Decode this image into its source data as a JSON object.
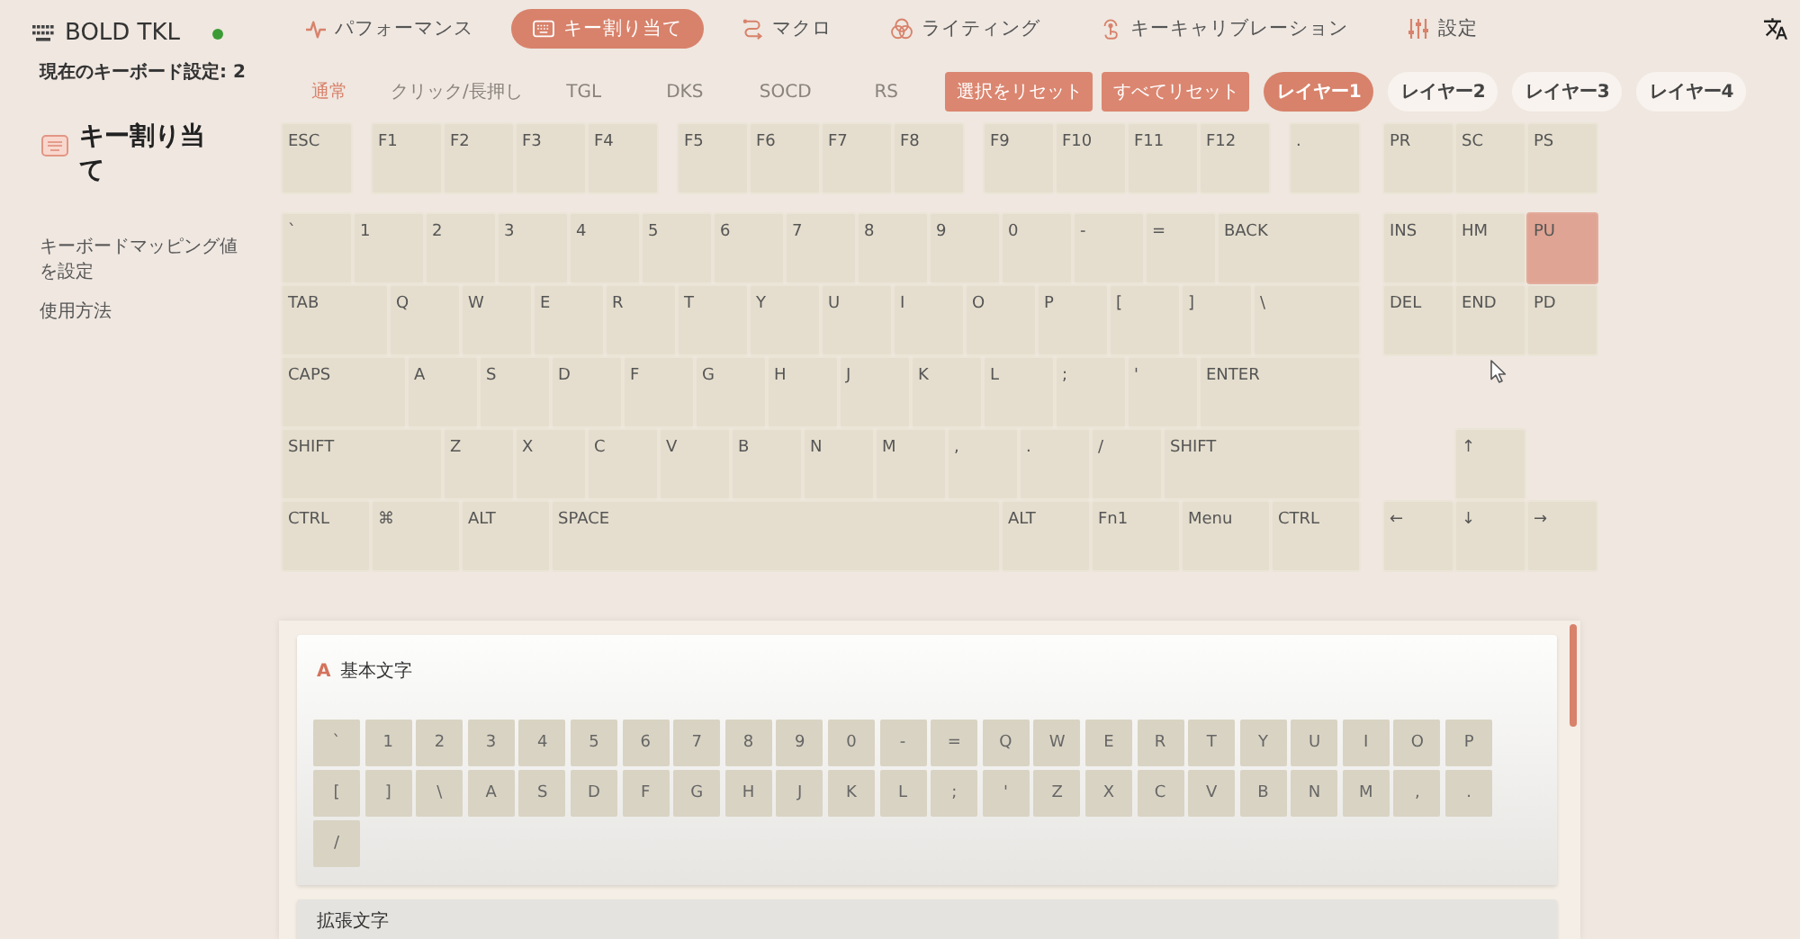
{
  "sidebar": {
    "device": {
      "name": "BOLD TKL",
      "connected": true
    },
    "profile": "現在のキーボード設定: 2",
    "section": "キー割り当て",
    "links": [
      "キーボードマッピング値を設定",
      "使用方法"
    ]
  },
  "nav": [
    {
      "label": "パフォーマンス",
      "selected": false
    },
    {
      "label": "キー割り当て",
      "selected": true
    },
    {
      "label": "マクロ",
      "selected": false
    },
    {
      "label": "ライティング",
      "selected": false
    },
    {
      "label": "キーキャリブレーション",
      "selected": false
    },
    {
      "label": "設定",
      "selected": false
    }
  ],
  "modes": [
    {
      "label": "通常",
      "selected": true
    },
    {
      "label": "クリック/長押し",
      "selected": false
    },
    {
      "label": "TGL",
      "selected": false
    },
    {
      "label": "DKS",
      "selected": false
    },
    {
      "label": "SOCD",
      "selected": false
    },
    {
      "label": "RS",
      "selected": false
    }
  ],
  "actions": [
    "選択をリセット",
    "すべてリセット"
  ],
  "layers": [
    {
      "label": "レイヤー1",
      "selected": true
    },
    {
      "label": "レイヤー2",
      "selected": false
    },
    {
      "label": "レイヤー3",
      "selected": false
    },
    {
      "label": "レイヤー4",
      "selected": false
    }
  ],
  "keyboard": {
    "function_row": [
      [
        {
          "label": "ESC",
          "selected": false
        }
      ],
      [
        {
          "label": "F1",
          "selected": false
        },
        {
          "label": "F2",
          "selected": false
        },
        {
          "label": "F3",
          "selected": false
        },
        {
          "label": "F4",
          "selected": false
        }
      ],
      [
        {
          "label": "F5",
          "selected": false
        },
        {
          "label": "F6",
          "selected": false
        },
        {
          "label": "F7",
          "selected": false
        },
        {
          "label": "F8",
          "selected": false
        }
      ],
      [
        {
          "label": "F9",
          "selected": false
        },
        {
          "label": "F10",
          "selected": false
        },
        {
          "label": "F11",
          "selected": false
        },
        {
          "label": "F12",
          "selected": false
        }
      ],
      [
        {
          "label": ".",
          "selected": false
        }
      ]
    ],
    "main_rows": [
      [
        {
          "label": "`",
          "selected": false
        },
        {
          "label": "1",
          "selected": false
        },
        {
          "label": "2",
          "selected": false
        },
        {
          "label": "3",
          "selected": false
        },
        {
          "label": "4",
          "selected": false
        },
        {
          "label": "5",
          "selected": false
        },
        {
          "label": "6",
          "selected": false
        },
        {
          "label": "7",
          "selected": false
        },
        {
          "label": "8",
          "selected": false
        },
        {
          "label": "9",
          "selected": false
        },
        {
          "label": "0",
          "selected": false
        },
        {
          "label": "-",
          "selected": false
        },
        {
          "label": "=",
          "selected": false
        },
        {
          "label": "BACK",
          "selected": false
        }
      ],
      [
        {
          "label": "TAB",
          "selected": false
        },
        {
          "label": "Q",
          "selected": false
        },
        {
          "label": "W",
          "selected": false
        },
        {
          "label": "E",
          "selected": false
        },
        {
          "label": "R",
          "selected": false
        },
        {
          "label": "T",
          "selected": false
        },
        {
          "label": "Y",
          "selected": false
        },
        {
          "label": "U",
          "selected": false
        },
        {
          "label": "I",
          "selected": false
        },
        {
          "label": "O",
          "selected": false
        },
        {
          "label": "P",
          "selected": false
        },
        {
          "label": "[",
          "selected": false
        },
        {
          "label": "]",
          "selected": false
        },
        {
          "label": "\\",
          "selected": false
        }
      ],
      [
        {
          "label": "CAPS",
          "selected": false
        },
        {
          "label": "A",
          "selected": false
        },
        {
          "label": "S",
          "selected": false
        },
        {
          "label": "D",
          "selected": false
        },
        {
          "label": "F",
          "selected": false
        },
        {
          "label": "G",
          "selected": false
        },
        {
          "label": "H",
          "selected": false
        },
        {
          "label": "J",
          "selected": false
        },
        {
          "label": "K",
          "selected": false
        },
        {
          "label": "L",
          "selected": false
        },
        {
          "label": ";",
          "selected": false
        },
        {
          "label": "'",
          "selected": false
        },
        {
          "label": "ENTER",
          "selected": false
        }
      ],
      [
        {
          "label": "SHIFT",
          "selected": false
        },
        {
          "label": "Z",
          "selected": false
        },
        {
          "label": "X",
          "selected": false
        },
        {
          "label": "C",
          "selected": false
        },
        {
          "label": "V",
          "selected": false
        },
        {
          "label": "B",
          "selected": false
        },
        {
          "label": "N",
          "selected": false
        },
        {
          "label": "M",
          "selected": false
        },
        {
          "label": ",",
          "selected": false
        },
        {
          "label": ".",
          "selected": false
        },
        {
          "label": "/",
          "selected": false
        },
        {
          "label": "SHIFT",
          "selected": false
        }
      ],
      [
        {
          "label": "CTRL",
          "selected": false
        },
        {
          "label": "⌘",
          "selected": false
        },
        {
          "label": "ALT",
          "selected": false
        },
        {
          "label": "SPACE",
          "selected": false
        },
        {
          "label": "ALT",
          "selected": false
        },
        {
          "label": "Fn1",
          "selected": false
        },
        {
          "label": "Menu",
          "selected": false
        },
        {
          "label": "CTRL",
          "selected": false
        }
      ]
    ],
    "nav_rows": [
      [
        {
          "label": "PR",
          "selected": false
        },
        {
          "label": "SC",
          "selected": false
        },
        {
          "label": "PS",
          "selected": false
        }
      ],
      [
        {
          "label": "INS",
          "selected": false
        },
        {
          "label": "HM",
          "selected": false
        },
        {
          "label": "PU",
          "selected": true
        }
      ],
      [
        {
          "label": "DEL",
          "selected": false
        },
        {
          "label": "END",
          "selected": false
        },
        {
          "label": "PD",
          "selected": false
        }
      ]
    ],
    "arrows": [
      {
        "label": "↑",
        "selected": false
      },
      {
        "label": "←",
        "selected": false
      },
      {
        "label": "↓",
        "selected": false
      },
      {
        "label": "→",
        "selected": false
      }
    ]
  },
  "panels": [
    {
      "mark": "A",
      "title": "基本文字",
      "keys": [
        "`",
        "1",
        "2",
        "3",
        "4",
        "5",
        "6",
        "7",
        "8",
        "9",
        "0",
        "-",
        "=",
        "Q",
        "W",
        "E",
        "R",
        "T",
        "Y",
        "U",
        "I",
        "O",
        "P",
        "[",
        "]",
        "\\",
        "A",
        "S",
        "D",
        "F",
        "G",
        "H",
        "J",
        "K",
        "L",
        ";",
        "'",
        "Z",
        "X",
        "C",
        "V",
        "B",
        "N",
        "M",
        ",",
        ".",
        "/"
      ]
    },
    {
      "title": "拡張文字"
    }
  ]
}
